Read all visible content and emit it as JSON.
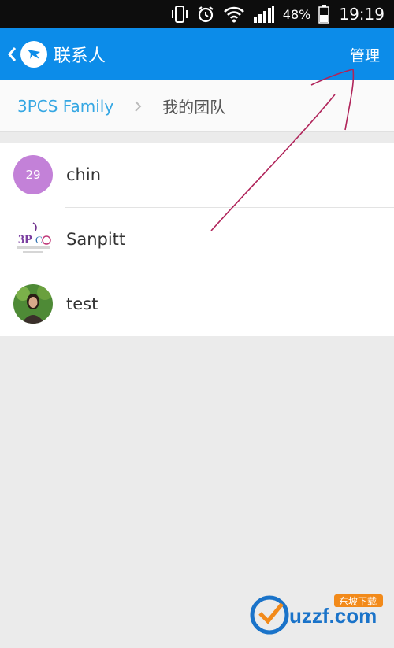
{
  "status_bar": {
    "battery_percent": "48%",
    "time": "19:19",
    "icons": [
      "vibrate-icon",
      "alarm-icon",
      "wifi-icon",
      "signal-icon",
      "battery-icon"
    ]
  },
  "app_bar": {
    "title": "联系人",
    "action_label": "管理",
    "back_icon": "chevron-left-icon",
    "logo_icon": "app-logo-icon",
    "color": "#0c8ce9"
  },
  "breadcrumb": {
    "root": "3PCS Family",
    "current": "我的团队",
    "root_color": "#35a7e3"
  },
  "contacts": [
    {
      "name": "chin",
      "avatar_text": "29",
      "avatar_color": "#c381d8"
    },
    {
      "name": "Sanpitt",
      "avatar_image": "3pcs-family-shop-logo"
    },
    {
      "name": "test",
      "avatar_image": "person-photo"
    }
  ],
  "avatar_logo_text": "3PCS Family Shop",
  "watermark": {
    "text": "uzzf.com",
    "subtitle": "东坡下载"
  }
}
